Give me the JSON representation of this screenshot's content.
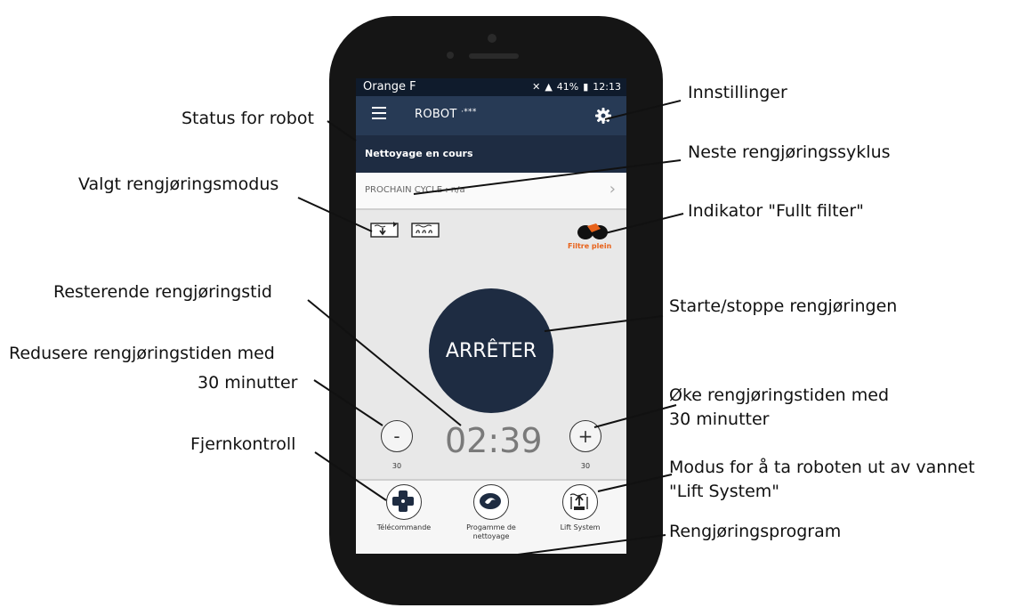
{
  "phone": {
    "statusbar": {
      "carrier": "Orange F",
      "battery": "41%",
      "time": "12:13"
    },
    "appbar": {
      "title": "ROBOT",
      "title_suffix": "·***"
    },
    "robot_status": "Nettoyage en cours",
    "next_cycle": {
      "label": "PROCHAIN CYCLE :",
      "value": "n/a"
    },
    "filter_indicator": {
      "label": "Filtre plein",
      "color": "#e8621a"
    },
    "start_stop_label": "ARRÊTER",
    "timer": "02:39",
    "decrease": {
      "symbol": "-",
      "minutes": "30"
    },
    "increase": {
      "symbol": "+",
      "minutes": "30"
    },
    "bottom_nav": [
      {
        "label": "Télécommande",
        "icon": "remote-control-icon"
      },
      {
        "label": "Progamme de nettoyage",
        "icon": "cleaning-program-icon"
      },
      {
        "label": "Lift System",
        "icon": "lift-system-icon"
      }
    ],
    "colors": {
      "appbar": "#273a55",
      "status": "#1e2c42",
      "accent": "#e8621a"
    }
  },
  "callouts": {
    "settings": "Innstillinger",
    "robot_status": "Status for robot",
    "next_cycle": "Neste rengjøringssyklus",
    "cleaning_mode": "Valgt rengjøringsmodus",
    "full_filter": "Indikator \"Fullt filter\"",
    "remaining_time": "Resterende rengjøringstid",
    "start_stop": "Starte/stoppe rengjøringen",
    "decrease_line1": "Redusere rengjøringstiden med",
    "decrease_line2": "30 minutter",
    "increase_line1": "Øke  rengjøringstiden  med",
    "increase_line2": "30 minutter",
    "remote": "Fjernkontroll",
    "lift_line1": "Modus for å ta roboten ut av vannet",
    "lift_line2": "\"Lift System\"",
    "program": "Rengjøringsprogram"
  }
}
